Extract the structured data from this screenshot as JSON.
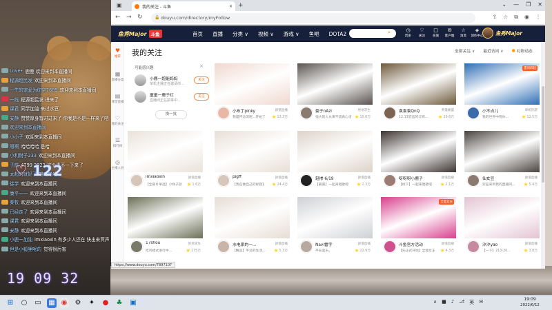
{
  "overlay": {
    "chat": [
      {
        "name": "Love•",
        "msg": "鹿鹿 欢迎来到本直播间",
        "badge": ""
      },
      {
        "name": "程源超民发",
        "msg": "欢迎来到本直播间",
        "badge": "#e8a23a"
      },
      {
        "name": "一生的宠爱为你空7689",
        "msg": "欢迎来到本直播间",
        "badge": ""
      },
      {
        "name": "一线",
        "msg": "程源超民发 进来了",
        "badge": "#d34"
      },
      {
        "name": "课君",
        "msg": "同学加油 来过水豆",
        "badge": "#e8a23a"
      },
      {
        "name": "安静",
        "msg": "赞赞厚身暂时过来了 你我是不是一样来了吧",
        "badge": "#4a8"
      },
      {
        "name": "欢迎来到本直播间",
        "msg": "",
        "badge": ""
      },
      {
        "name": "小小子",
        "msg": "欢迎来到本直播间",
        "badge": ""
      },
      {
        "name": "嗯啊",
        "msg": "哈哈哈哈 是哈",
        "badge": ""
      },
      {
        "name": "小利耐子233",
        "msg": "欢迎来到本直播间",
        "badge": ""
      },
      {
        "name": "子航",
        "msg": "4799 3923 这个事不一下来了",
        "badge": "#e8a23a"
      },
      {
        "name": "太超的就好了",
        "msg": "哈哈哈哈",
        "badge": ""
      },
      {
        "name": "徐学",
        "msg": "欢迎来到本直播间",
        "badge": ""
      },
      {
        "name": "康平一一",
        "msg": "欢迎来到本直播间",
        "badge": "#4a8"
      },
      {
        "name": "秦牧",
        "msg": "欢迎来到本直播间",
        "badge": "#e8a23a"
      },
      {
        "name": "已经走了",
        "msg": "欢迎来到本直播间",
        "badge": ""
      },
      {
        "name": "课君",
        "msg": "欢迎来到本直播间",
        "badge": ""
      },
      {
        "name": "安静",
        "msg": "欢迎来到本直播间",
        "badge": ""
      },
      {
        "name": "小鹿一加油",
        "msg": "imxiaoxin 有多少人还在 快出来冥声",
        "badge": "#4a8"
      },
      {
        "name": "但是小狐狸呢的",
        "msg": "觉得很厉害",
        "badge": ""
      }
    ],
    "like_count": "122",
    "clock": "19 09 32"
  },
  "browser": {
    "tab_title": "我的关注 - 斗鱼",
    "url": "douyu.com/directory/myFollow",
    "status_url": "https://www.douyu.com/7897107"
  },
  "site": {
    "brand": "鱼秀Major",
    "brand_mark": "斗鱼",
    "nav": [
      "首页",
      "直播",
      "分类 ∨",
      "视频 ∨",
      "游戏 ∨",
      "鱼吧",
      "DOTA2"
    ],
    "header_icons": [
      {
        "glyph": "◷",
        "label": "历史"
      },
      {
        "glyph": "♡",
        "label": "关注"
      },
      {
        "glyph": "□",
        "label": "充值"
      },
      {
        "glyph": "✉",
        "label": "客户端"
      },
      {
        "glyph": "☆",
        "label": "消息"
      },
      {
        "glyph": "◈",
        "label": "创作中心"
      }
    ],
    "user_name": "鱼秀Major",
    "rail": [
      "推荐",
      "直播分类",
      "课堂直播",
      "我的关注",
      "排行榜",
      "主播入驻"
    ]
  },
  "page": {
    "title": "我的关注",
    "filter_all": "全部关注 ∨",
    "filter_recent": "最近访问 ∨",
    "gift_link": "礼物动态"
  },
  "recommend": {
    "heading": "可能感兴趣",
    "items": [
      {
        "name": "小鹿一超能妈妈",
        "desc": "单机主播正在邀请你...",
        "follow": "关注"
      },
      {
        "name": "童童一鹿子红",
        "desc": "直播间正在搞事中...",
        "follow": "关注"
      }
    ],
    "refresh": "换一批"
  },
  "cards": [
    {
      "name": "小布丁pinky",
      "title": "我是怀念的呢...开始了",
      "cat": "颜值直播",
      "heat": "⭐ 13.3万",
      "badge": "",
      "color": "#f0d8ce",
      "av": "#e9b7a6"
    },
    {
      "name": "娄子nAzi",
      "title": "强大的人从来不说真心话",
      "cat": "绝地求生",
      "heat": "⭐ 15.6万",
      "badge": "",
      "color": "#5a5450",
      "av": "#8a7a70"
    },
    {
      "name": "袁袁袁QnQ",
      "title": "12.13宏远的订阅...",
      "cat": "英雄联盟",
      "heat": "⭐ 19.6万",
      "badge": "",
      "color": "#6e5a3c",
      "av": "#7d6452"
    },
    {
      "name": "小不点儿",
      "title": "我的世界中有你...",
      "cat": "单机热游",
      "heat": "⭐ 12.5万",
      "badge": "夏风四起",
      "color": "#2f6fb5",
      "av": "#3a6aa8"
    },
    {
      "name": "imxiaoxin",
      "title": "【全部片单选】小样子就是最好的",
      "cat": "颜值直播",
      "heat": "⭐ 1.6万",
      "badge": "",
      "color": "#eae2da",
      "av": "#d5c6b8"
    },
    {
      "name": "pigff",
      "title": "【我在做自己的标题】",
      "cat": "颜值直播",
      "heat": "⭐ 24.4万",
      "badge": "",
      "color": "#e8dfd6",
      "av": "#d7c7ba"
    },
    {
      "name": "轻掺·6/19",
      "title": "【最美】一起来唱歌吧",
      "cat": "颜值直播",
      "heat": "⭐ 2.3万",
      "badge": "",
      "color": "#ddd3c9",
      "av": "#222"
    },
    {
      "name": "呀呀呀小鹿子",
      "title": "【线下】一起来唱歌吧",
      "cat": "颜值直播",
      "heat": "⭐ 2.1万",
      "badge": "",
      "color": "#3c3432",
      "av": "#9a7c74"
    },
    {
      "name": "仙女豆",
      "title": "欢迎来到我的直播间...",
      "cat": "颜值直播",
      "heat": "⭐ 5.4万",
      "badge": "",
      "color": "#4a4440",
      "av": "#8c7a70"
    },
    {
      "name": "17shou",
      "title": "吃鸡模式进行中...",
      "cat": "绝地求生",
      "heat": "⭐ 175万",
      "badge": "",
      "color": "#6b7056",
      "av": "#7a7a6a"
    },
    {
      "name": "水电家的一...",
      "title": "【精品】平淡的生活...",
      "cat": "颜值直播",
      "heat": "⭐ 5.3万",
      "badge": "",
      "color": "#e6ddd4",
      "av": "#c9b4a8"
    },
    {
      "name": "Navi雷字",
      "title": "平安喜乐。",
      "cat": "颜值直播",
      "heat": "⭐ 22.9万",
      "badge": "",
      "color": "#cfd0d4",
      "av": "#b8a9a0"
    },
    {
      "name": "斗鱼官方活动",
      "title": "【先正式开始】全能女王",
      "cat": "颜值直播",
      "heat": "⭐ 4.3万",
      "badge": "全能女王",
      "color": "#d93f8d",
      "av": "#d0508e"
    },
    {
      "name": "汐汐yao",
      "title": "【一下】213-20...",
      "cat": "颜值直播",
      "heat": "⭐ 3.8万",
      "badge": "",
      "color": "#e3c4d2",
      "av": "#c58aa0"
    }
  ],
  "taskbar": {
    "time": "19:09",
    "date": "2022/6/12",
    "tray": [
      "∧",
      "■",
      "♪",
      "⎇",
      "英",
      "✉"
    ]
  }
}
